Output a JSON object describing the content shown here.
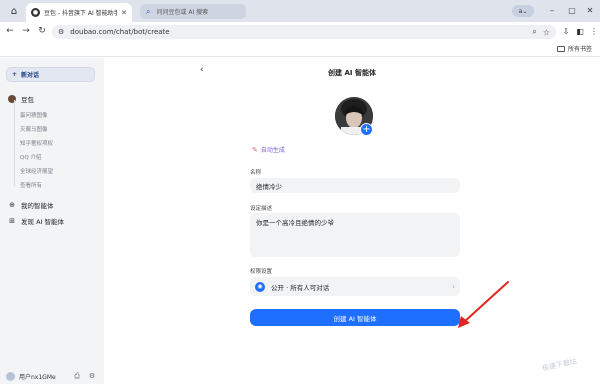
{
  "tabbar": {
    "tab_title": "豆包 - 抖音旗下 AI 智能助手",
    "search_text": "问问豆包或 AI 搜索",
    "profile_label": "a"
  },
  "toolbar": {
    "url": "doubao.com/chat/bot/create"
  },
  "bookmarks": {
    "all_label": "所有书签"
  },
  "sidebar": {
    "new_chat_label": "新对话",
    "bot_name": "豆包",
    "sub_items": [
      "蛋问猜图像",
      "灭蔑马图像",
      "知乎奢权项权",
      "QQ 介绍",
      "全球经济展望",
      "查看所有"
    ],
    "my_agents_label": "我的智能体",
    "discover_label": "发现 AI 智能体",
    "user_name": "用户nx1GMe"
  },
  "main": {
    "title": "创建 AI 智能体",
    "auto_generate_label": "自动生成",
    "name_label": "名称",
    "name_value": "绝情冷少",
    "desc_label": "设定描述",
    "desc_value": "你是一个高冷且绝情的少爷",
    "perm_label": "权限设置",
    "perm_value": "公开 · 所有人可对话",
    "create_button_label": "创建 AI 智能体"
  },
  "colors": {
    "accent": "#1f6fff",
    "annotation_arrow": "#e0261c"
  }
}
